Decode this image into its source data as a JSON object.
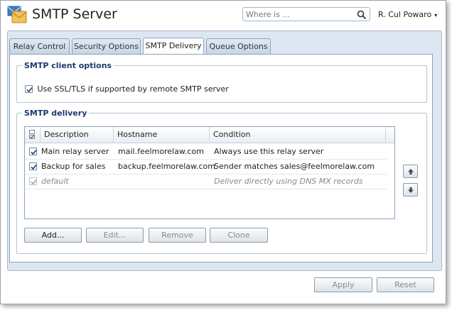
{
  "window": {
    "title": "SMTP Server"
  },
  "header": {
    "search_placeholder": "Where is ...",
    "user_name": "R. Cul Powaro",
    "user_caret": "▾"
  },
  "tabs": [
    {
      "label": "Relay Control",
      "active": false
    },
    {
      "label": "Security Options",
      "active": false
    },
    {
      "label": "SMTP Delivery",
      "active": true
    },
    {
      "label": "Queue Options",
      "active": false
    }
  ],
  "client_options": {
    "legend": "SMTP client options",
    "ssl_label": "Use SSL/TLS if supported by remote SMTP server",
    "ssl_checked": true
  },
  "delivery": {
    "legend": "SMTP delivery",
    "columns": [
      "Description",
      "Hostname",
      "Condition"
    ],
    "rows": [
      {
        "checked": true,
        "description": "Main relay server",
        "hostname": "mail.feelmorelaw.com",
        "condition": "Always use this relay server",
        "is_default": false
      },
      {
        "checked": true,
        "description": "Backup for sales",
        "hostname": "backup.feelmorelaw.com",
        "condition": "Sender matches sales@feelmorelaw.com",
        "is_default": false
      },
      {
        "checked": true,
        "description": "default",
        "hostname": "",
        "condition": "Deliver directly using DNS MX records",
        "is_default": true
      }
    ],
    "buttons": {
      "add": "Add...",
      "edit": "Edit...",
      "remove": "Remove",
      "clone": "Clone"
    }
  },
  "footer": {
    "apply": "Apply",
    "reset": "Reset"
  },
  "colors": {
    "accent_text": "#1b3a6b",
    "panel_bg": "#dde7f2",
    "check_mark": "#1f3f75"
  }
}
